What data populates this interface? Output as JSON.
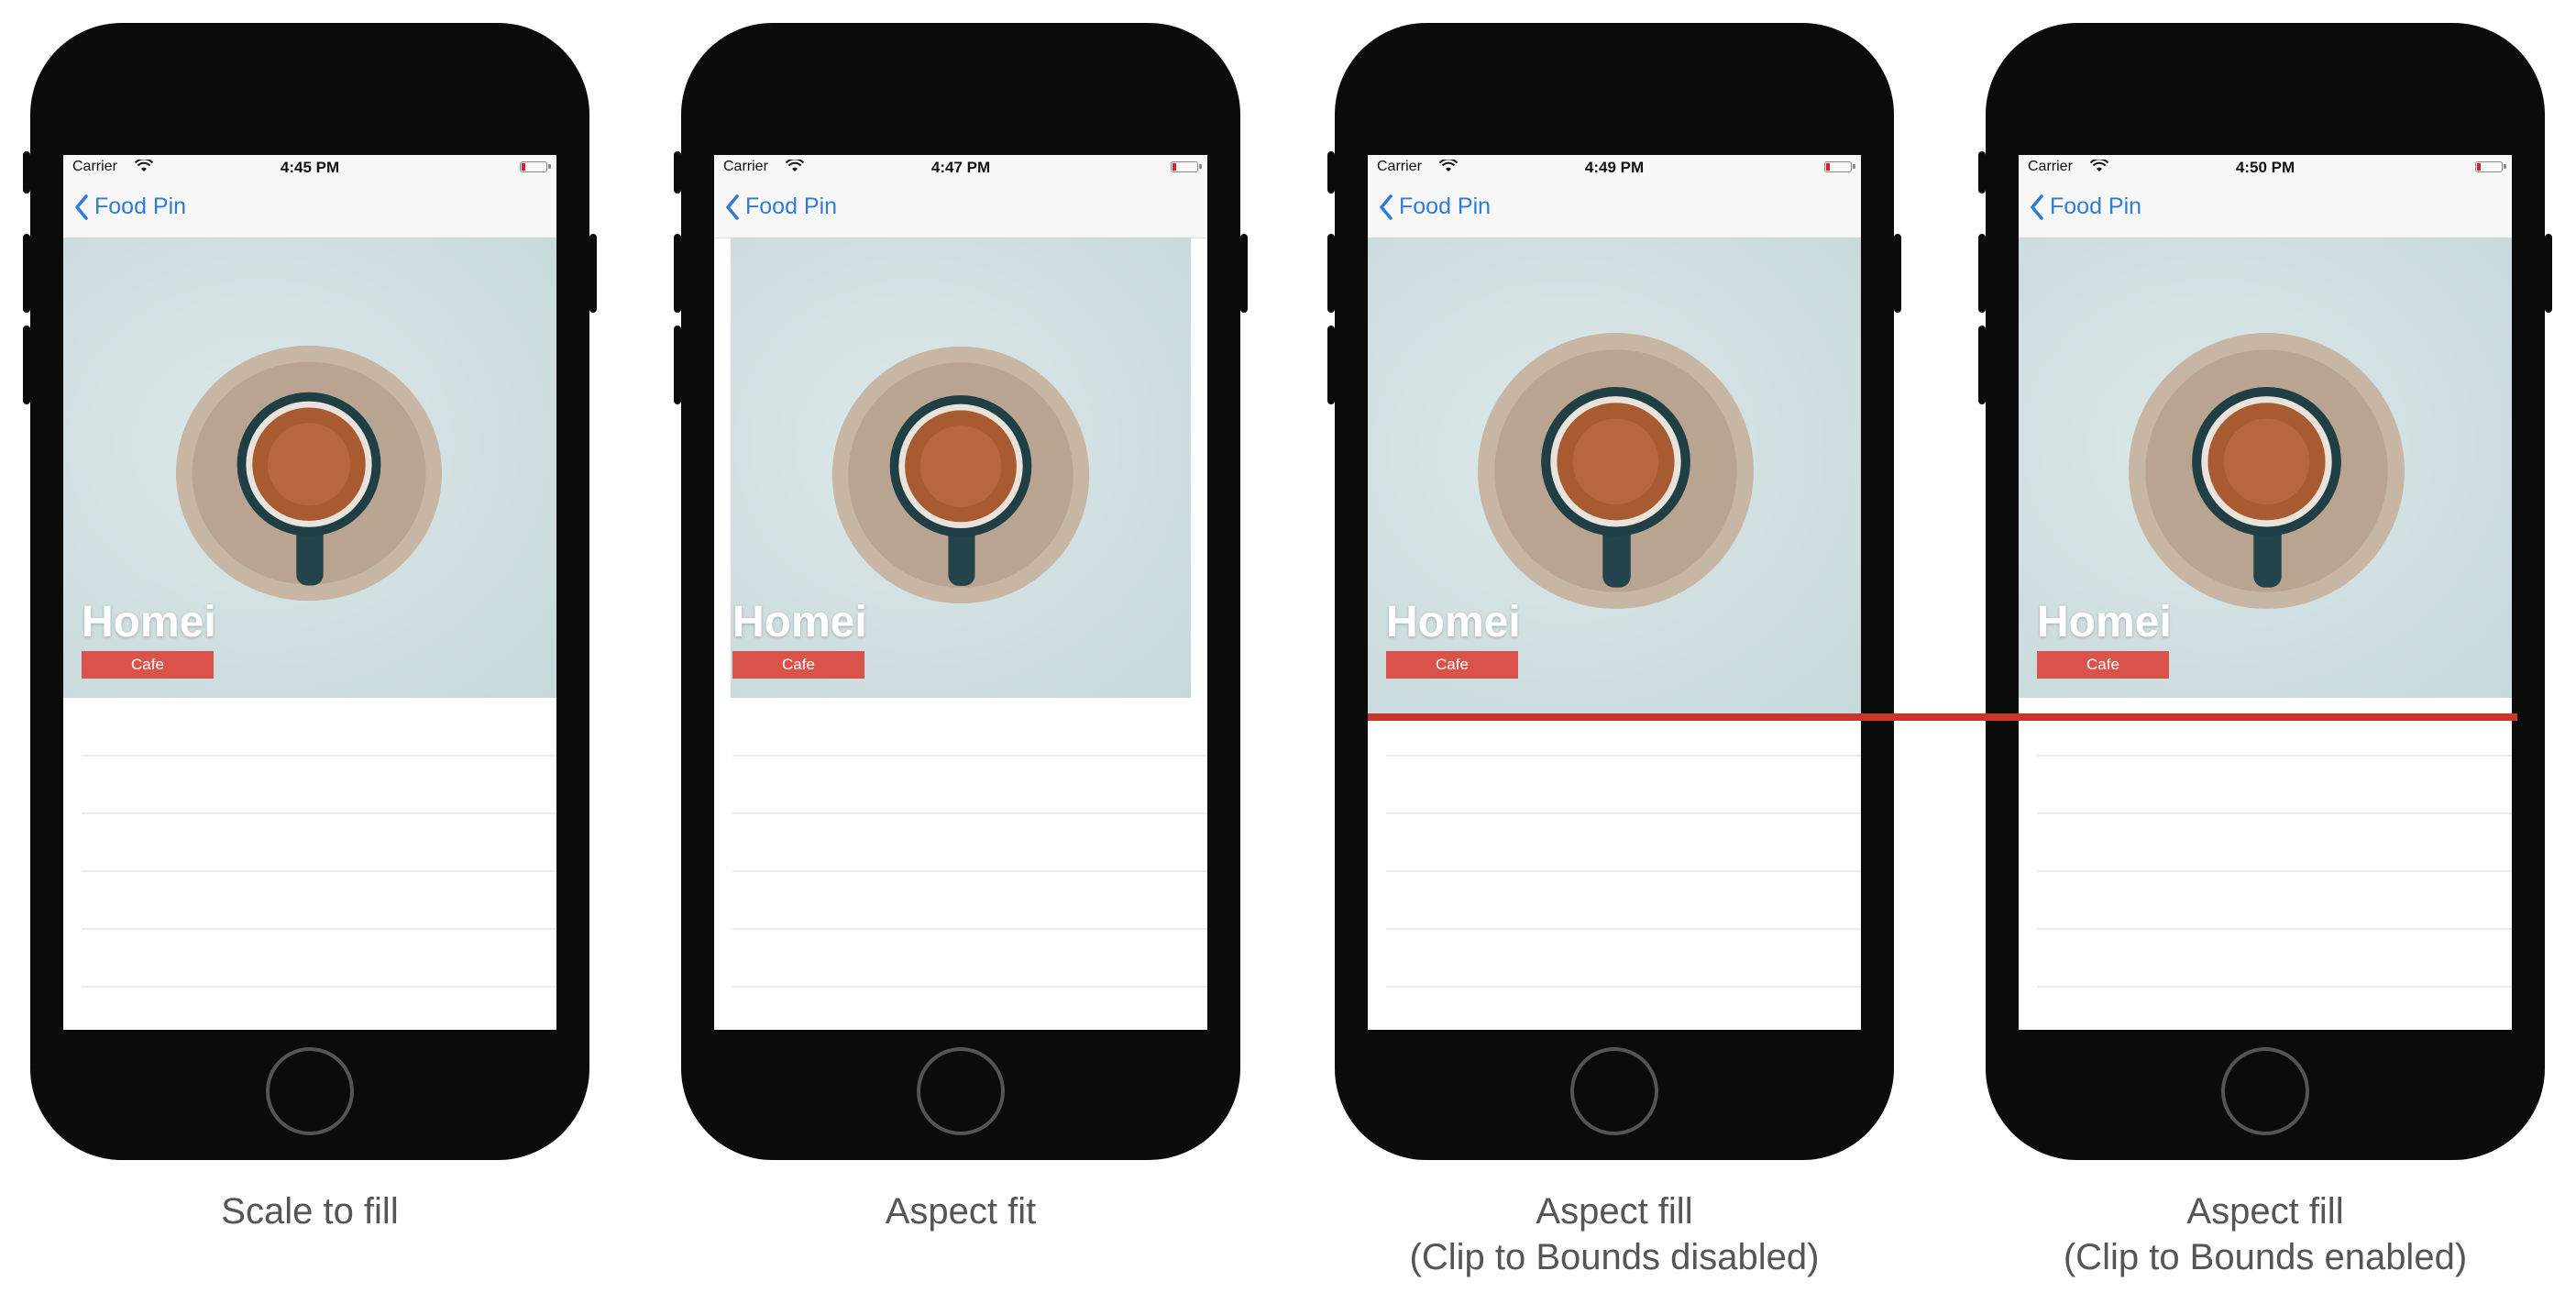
{
  "status_bar": {
    "carrier": "Carrier"
  },
  "nav": {
    "back_label": "Food Pin"
  },
  "restaurant": {
    "name": "Homei",
    "type": "Cafe"
  },
  "colors": {
    "tint": "#2f7bd8",
    "badge": "#d9534a",
    "highlight_line": "#c9362b",
    "battery_low": "#e02020"
  },
  "icons": [
    "chevron-left-icon",
    "wifi-icon",
    "battery-icon"
  ],
  "phones": [
    {
      "id": "scale-to-fill",
      "time": "4:45 PM",
      "caption_line1": "Scale to fill",
      "caption_line2": ""
    },
    {
      "id": "aspect-fit",
      "time": "4:47 PM",
      "caption_line1": "Aspect fit",
      "caption_line2": ""
    },
    {
      "id": "aspect-fill-clip-disabled",
      "time": "4:49 PM",
      "caption_line1": "Aspect fill",
      "caption_line2": "(Clip to Bounds disabled)"
    },
    {
      "id": "aspect-fill-clip-enabled",
      "time": "4:50 PM",
      "caption_line1": "Aspect fill",
      "caption_line2": "(Clip to Bounds enabled)"
    }
  ]
}
